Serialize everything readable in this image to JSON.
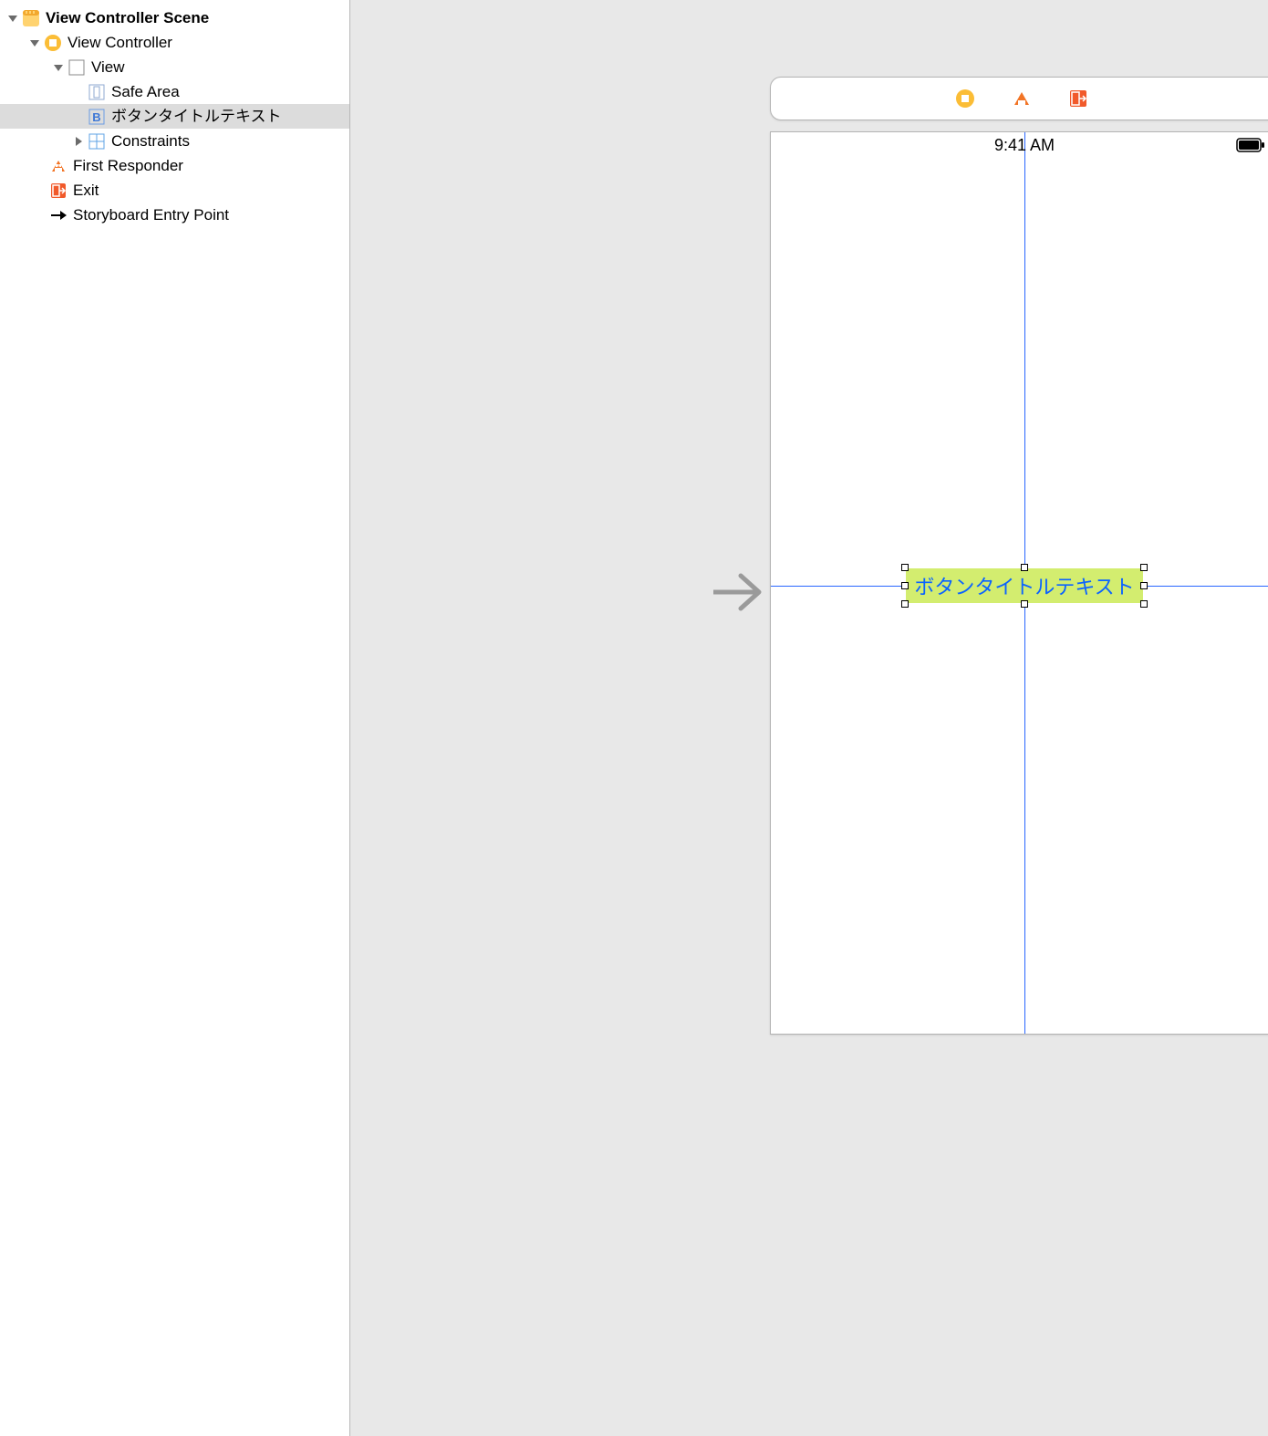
{
  "outline": {
    "scene": "View Controller Scene",
    "vc": "View Controller",
    "view": "View",
    "safe_area": "Safe Area",
    "button": "ボタンタイトルテキスト",
    "constraints": "Constraints",
    "first_responder": "First Responder",
    "exit": "Exit",
    "entry_point": "Storyboard Entry Point"
  },
  "canvas": {
    "status_time": "9:41 AM",
    "button_title": "ボタンタイトルテキスト"
  }
}
